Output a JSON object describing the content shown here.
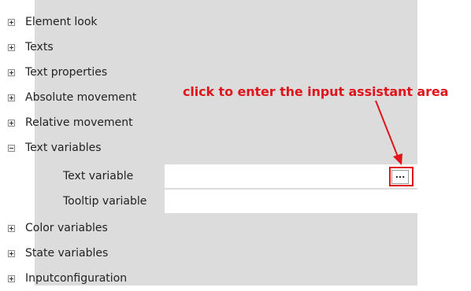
{
  "property_tree": {
    "rows": [
      {
        "label": "Element look",
        "expanded": false
      },
      {
        "label": "Texts",
        "expanded": false
      },
      {
        "label": "Text properties",
        "expanded": false
      },
      {
        "label": "Absolute movement",
        "expanded": false
      },
      {
        "label": "Relative movement",
        "expanded": false
      },
      {
        "label": "Text variables",
        "expanded": true
      },
      {
        "label": "Color variables",
        "expanded": false
      },
      {
        "label": "State variables",
        "expanded": false
      },
      {
        "label": "Inputconfiguration",
        "expanded": false
      }
    ],
    "sub_rows": [
      {
        "label": "Text variable",
        "value": "",
        "button_label": "..."
      },
      {
        "label": "Tooltip variable",
        "value": ""
      }
    ]
  },
  "annotation": {
    "text": "click to enter the input assistant area",
    "color": "#e0151c"
  },
  "colors": {
    "panel_background": "#dcdcdc",
    "value_background": "#ffffff",
    "highlight": "#e0151c"
  }
}
